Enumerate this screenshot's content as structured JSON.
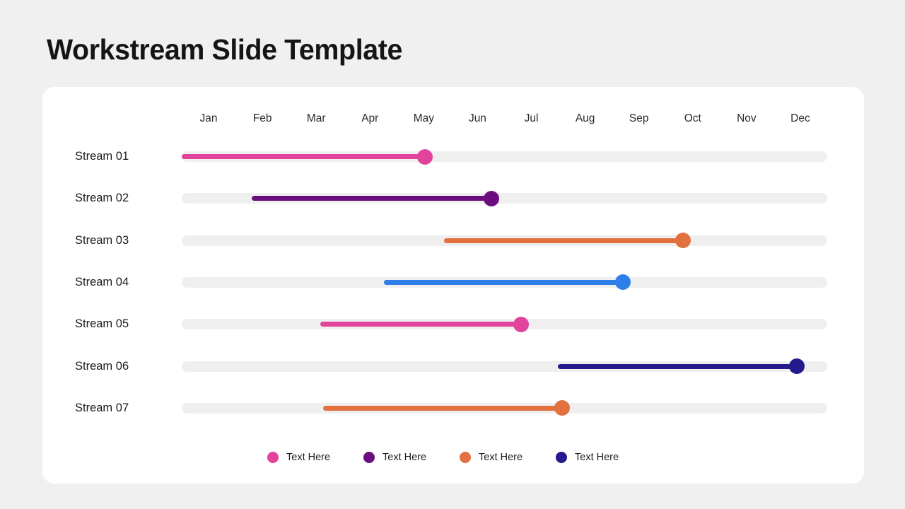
{
  "page": {
    "title": "Workstream Slide Template",
    "background_color": "#f0f0f0",
    "card_color": "#ffffff",
    "track_color": "#efefef"
  },
  "axis": {
    "months": [
      "Jan",
      "Feb",
      "Mar",
      "Apr",
      "May",
      "Jun",
      "Jul",
      "Aug",
      "Sep",
      "Oct",
      "Nov",
      "Dec"
    ]
  },
  "chart_data": {
    "type": "bar",
    "title": "Workstream Slide Template",
    "xlabel": "",
    "ylabel": "",
    "orientation": "horizontal",
    "categories": [
      "Stream 01",
      "Stream 02",
      "Stream 03",
      "Stream 04",
      "Stream 05",
      "Stream 06",
      "Stream 07"
    ],
    "x_tick_labels": [
      "Jan",
      "Feb",
      "Mar",
      "Apr",
      "May",
      "Jun",
      "Jul",
      "Aug",
      "Sep",
      "Oct",
      "Nov",
      "Dec"
    ],
    "xlim": [
      0,
      12
    ],
    "grid": false,
    "legend_position": "bottom",
    "series": [
      {
        "name": "Stream 01",
        "label": "Stream 01",
        "start_month": 0.0,
        "end_month": 4.52,
        "start_pct": 0.0,
        "end_pct": 37.7,
        "color": "#e2449b"
      },
      {
        "name": "Stream 02",
        "label": "Stream 02",
        "start_month": 1.3,
        "end_month": 5.76,
        "start_pct": 10.8,
        "end_pct": 48.0,
        "color": "#6b0d7e"
      },
      {
        "name": "Stream 03",
        "label": "Stream 03",
        "start_month": 4.87,
        "end_month": 9.32,
        "start_pct": 40.6,
        "end_pct": 77.7,
        "color": "#e2713f"
      },
      {
        "name": "Stream 04",
        "label": "Stream 04",
        "start_month": 3.76,
        "end_month": 8.2,
        "start_pct": 31.3,
        "end_pct": 68.3,
        "color": "#2e7fe8"
      },
      {
        "name": "Stream 05",
        "label": "Stream 05",
        "start_month": 2.58,
        "end_month": 6.31,
        "start_pct": 21.5,
        "end_pct": 52.6,
        "color": "#e2449b"
      },
      {
        "name": "Stream 06",
        "label": "Stream 06",
        "start_month": 6.99,
        "end_month": 11.43,
        "start_pct": 58.3,
        "end_pct": 95.3,
        "color": "#241a8c"
      },
      {
        "name": "Stream 07",
        "label": "Stream 07",
        "start_month": 2.63,
        "end_month": 7.07,
        "start_pct": 21.9,
        "end_pct": 58.9,
        "color": "#e2713f"
      }
    ],
    "legend": [
      {
        "label": "Text Here",
        "color": "#e2449b"
      },
      {
        "label": "Text Here",
        "color": "#6b0d7e"
      },
      {
        "label": "Text Here",
        "color": "#e2713f"
      },
      {
        "label": "Text Here",
        "color": "#241a8c"
      }
    ]
  }
}
